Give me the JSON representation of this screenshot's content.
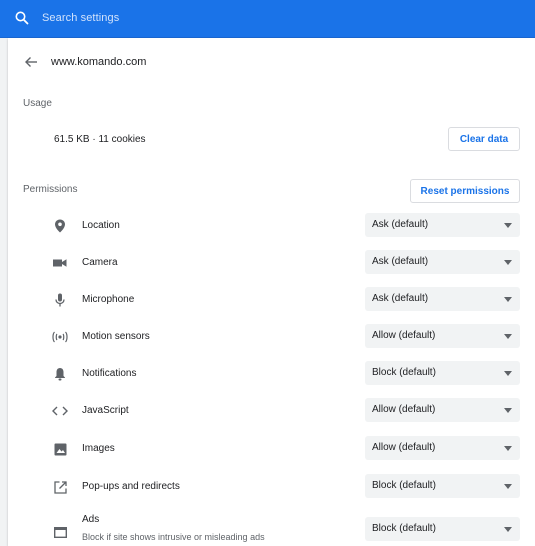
{
  "search": {
    "placeholder": "Search settings"
  },
  "site": {
    "title": "www.komando.com"
  },
  "usage": {
    "heading": "Usage",
    "value": "61.5 KB · 11 cookies",
    "clear_label": "Clear data"
  },
  "permissions": {
    "heading": "Permissions",
    "reset_label": "Reset permissions",
    "items": [
      {
        "label": "Location",
        "value": "Ask (default)",
        "icon": "location-pin-icon"
      },
      {
        "label": "Camera",
        "value": "Ask (default)",
        "icon": "camera-icon"
      },
      {
        "label": "Microphone",
        "value": "Ask (default)",
        "icon": "microphone-icon"
      },
      {
        "label": "Motion sensors",
        "value": "Allow (default)",
        "icon": "motion-sensors-icon"
      },
      {
        "label": "Notifications",
        "value": "Block (default)",
        "icon": "bell-icon"
      },
      {
        "label": "JavaScript",
        "value": "Allow (default)",
        "icon": "code-icon"
      },
      {
        "label": "Images",
        "value": "Allow (default)",
        "icon": "image-icon"
      },
      {
        "label": "Pop-ups and redirects",
        "value": "Block (default)",
        "icon": "open-in-new-icon"
      },
      {
        "label": "Ads",
        "sublabel": "Block if site shows intrusive or misleading ads",
        "value": "Block (default)",
        "icon": "ads-window-icon"
      }
    ]
  },
  "colors": {
    "accent": "#1a73e8",
    "background": "#f1f3f4",
    "icon": "#5f6368"
  }
}
